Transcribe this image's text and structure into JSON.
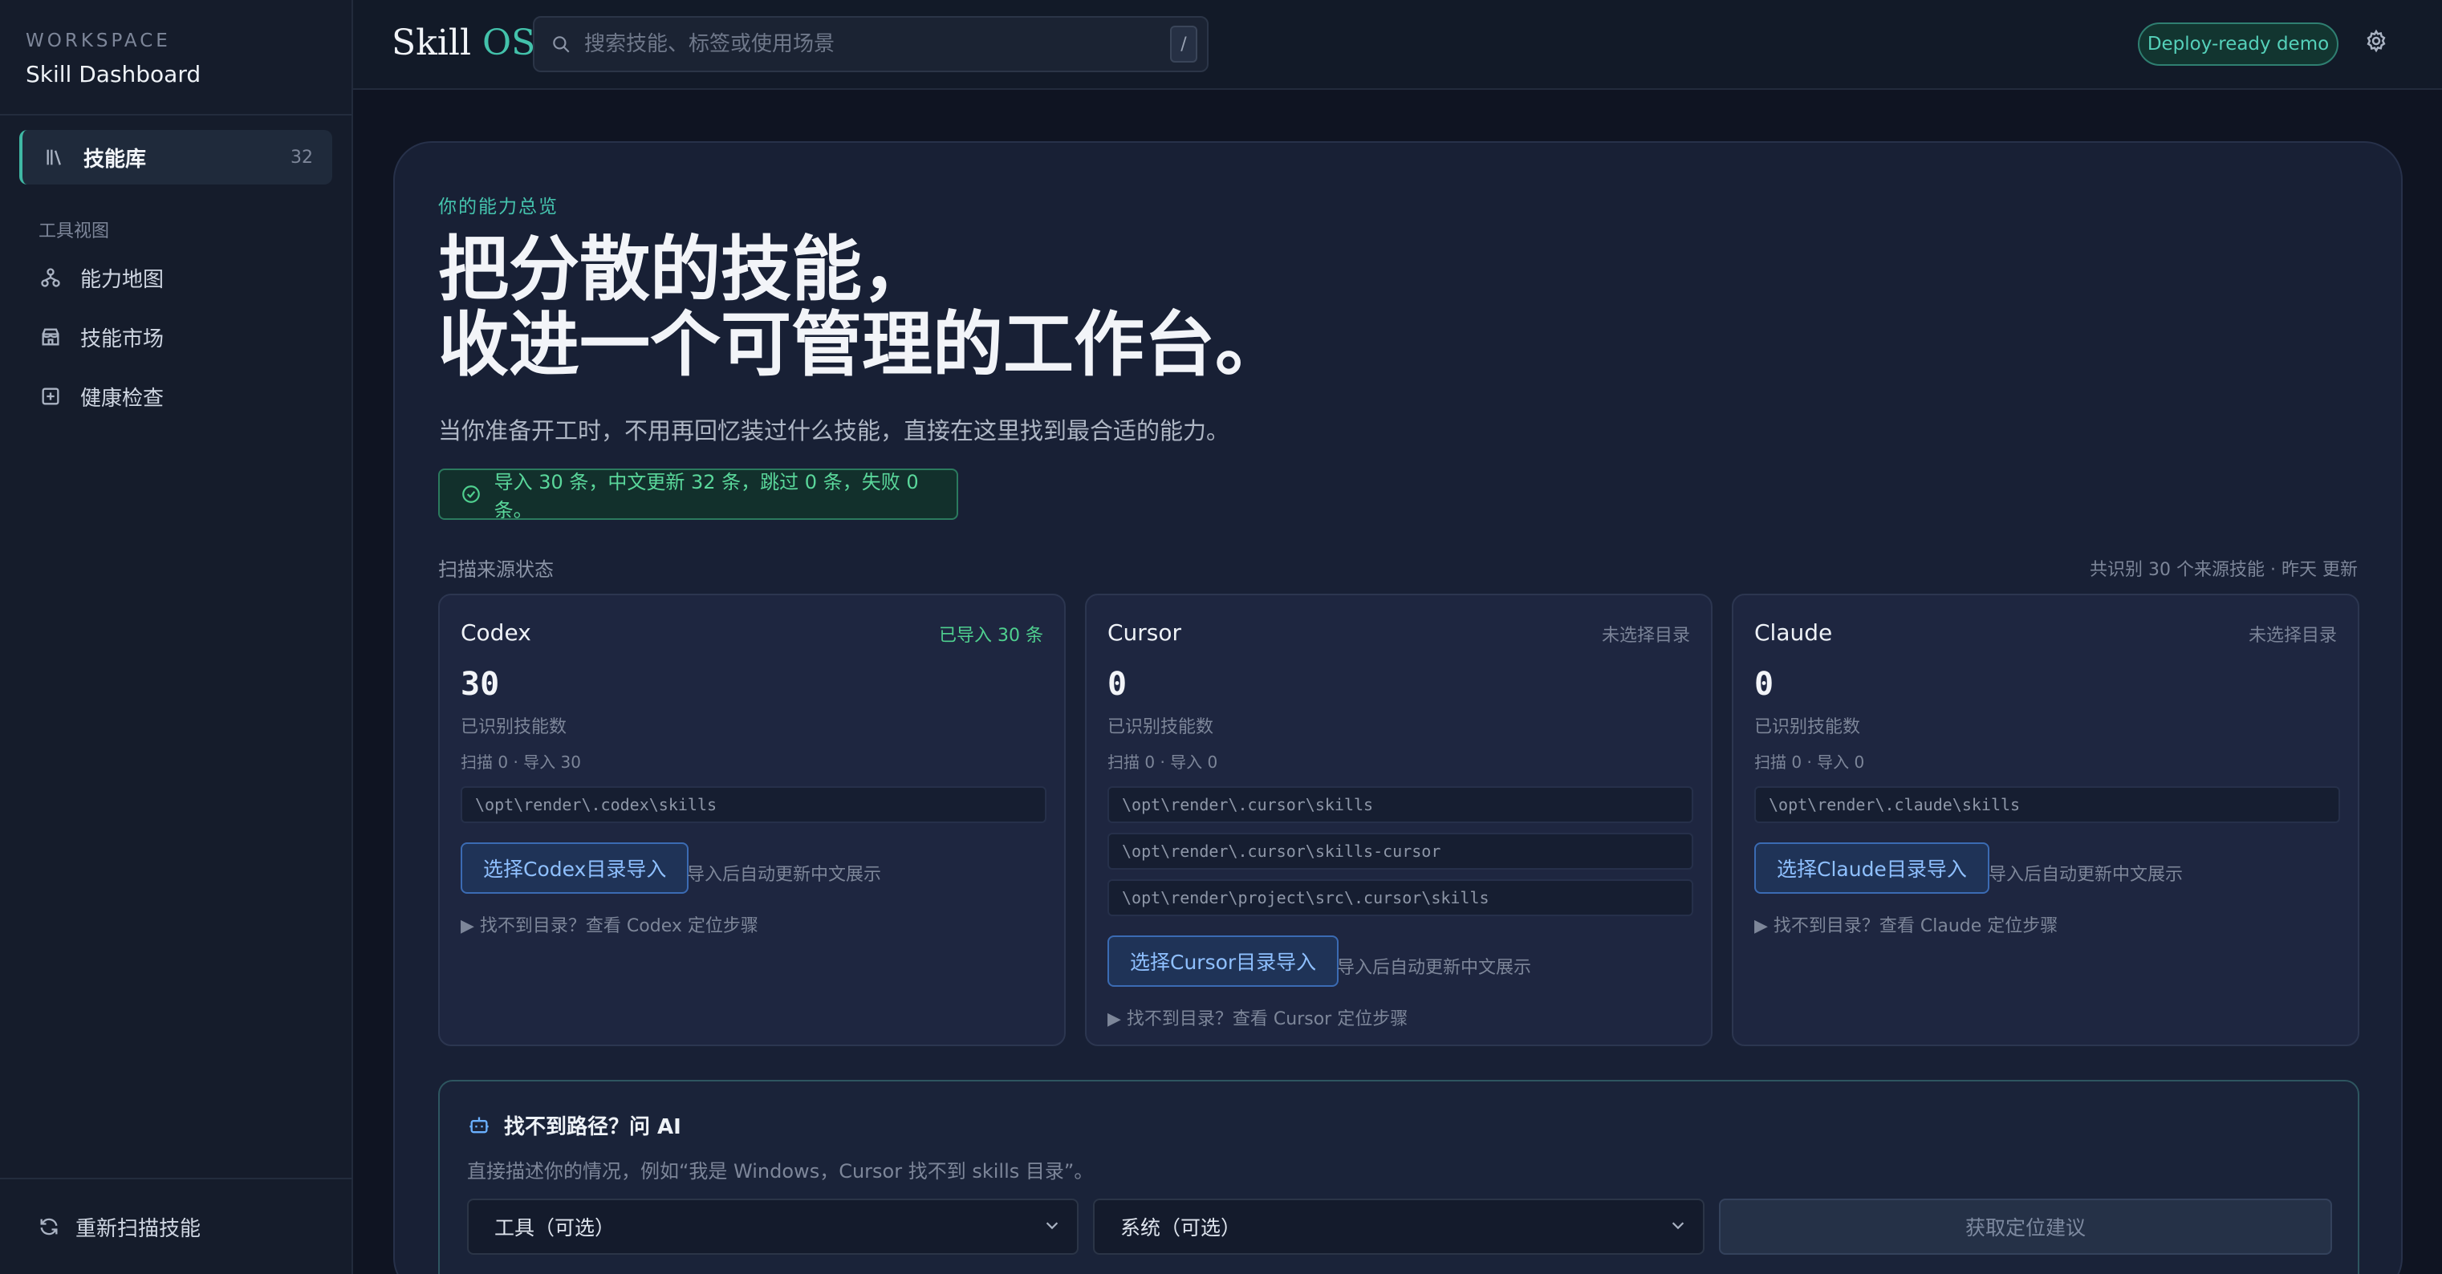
{
  "sidebar": {
    "workspace_eyebrow": "WORKSPACE",
    "workspace_title": "Skill Dashboard",
    "active_item": {
      "label": "技能库",
      "count": "32",
      "icon": "library-icon"
    },
    "group_title": "工具视图",
    "items": [
      {
        "label": "能力地图",
        "icon": "sitemap-icon"
      },
      {
        "label": "技能市场",
        "icon": "store-icon"
      },
      {
        "label": "健康检查",
        "icon": "health-check-icon"
      }
    ],
    "footer_label": "重新扫描技能",
    "footer_icon": "refresh-icon"
  },
  "topbar": {
    "brand_main": "Skill",
    "brand_accent": "OS",
    "search_placeholder": "搜索技能、标签或使用场景",
    "search_shortcut": "/",
    "deploy_badge": "Deploy-ready demo",
    "settings_icon": "gear-icon"
  },
  "main": {
    "eyebrow": "你的能力总览",
    "hero_line1": "把分散的技能，",
    "hero_line2": "收进一个可管理的工作台。",
    "subtitle": "当你准备开工时，不用再回忆装过什么技能，直接在这里找到最合适的能力。",
    "import_status": "导入 30 条，中文更新 32 条，跳过 0 条，失败 0 条。",
    "sources_title": "扫描来源状态",
    "sources_meta": "共识别 30 个来源技能 · 昨天 更新",
    "sources": [
      {
        "name": "Codex",
        "status": "已导入 30 条",
        "count": "30",
        "count_label": "已识别技能数",
        "scan": "扫描 0 · 导入 30",
        "paths": [
          "\\opt\\render\\.codex\\skills"
        ],
        "button": "选择Codex目录导入",
        "note": "导入后自动更新中文展示",
        "help": "▶ 找不到目录？查看 Codex 定位步骤"
      },
      {
        "name": "Cursor",
        "status": "未选择目录",
        "count": "0",
        "count_label": "已识别技能数",
        "scan": "扫描 0 · 导入 0",
        "paths": [
          "\\opt\\render\\.cursor\\skills",
          "\\opt\\render\\.cursor\\skills-cursor",
          "\\opt\\render\\project\\src\\.cursor\\skills"
        ],
        "button": "选择Cursor目录导入",
        "note": "导入后自动更新中文展示",
        "help": "▶ 找不到目录？查看 Cursor 定位步骤"
      },
      {
        "name": "Claude",
        "status": "未选择目录",
        "count": "0",
        "count_label": "已识别技能数",
        "scan": "扫描 0 · 导入 0",
        "paths": [
          "\\opt\\render\\.claude\\skills"
        ],
        "button": "选择Claude目录导入",
        "note": "导入后自动更新中文展示",
        "help": "▶ 找不到目录？查看 Claude 定位步骤"
      }
    ],
    "ask_ai": {
      "title": "找不到路径？问 AI",
      "icon": "robot-icon",
      "description": "直接描述你的情况，例如“我是 Windows，Cursor 找不到 skills 目录”。",
      "tool_select": "工具（可选）",
      "system_select": "系统（可选）",
      "submit": "获取定位建议"
    }
  },
  "colors": {
    "accent": "#43c2ab",
    "success": "#4fd08f",
    "link_blue": "#8fc0ff",
    "background": "#0f1422",
    "panel": "#182035"
  }
}
